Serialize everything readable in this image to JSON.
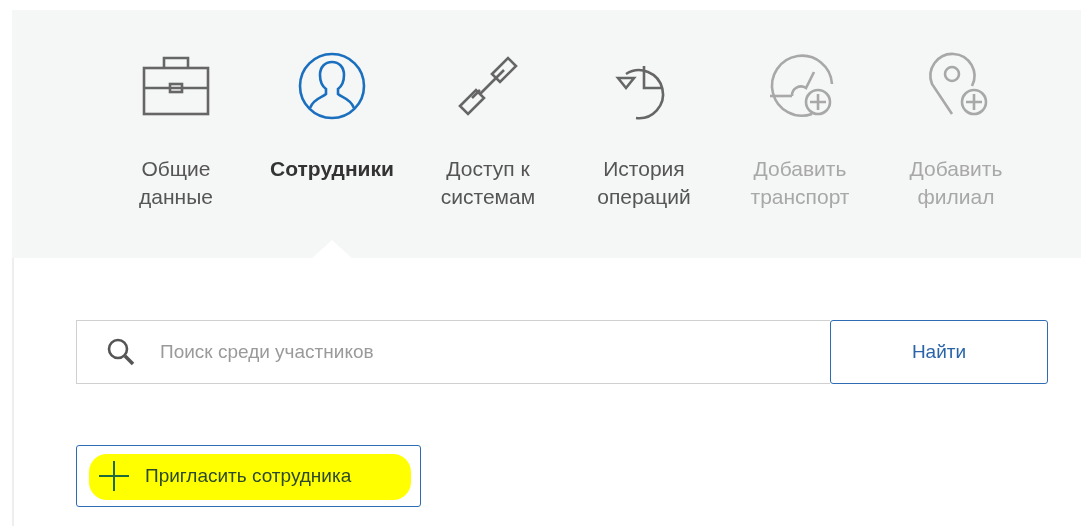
{
  "tabs": [
    {
      "label": "Общие\nданные",
      "selected": false,
      "disabled": false
    },
    {
      "label": "Сотрудники",
      "selected": true,
      "disabled": false
    },
    {
      "label": "Доступ к\nсистемам",
      "selected": false,
      "disabled": false
    },
    {
      "label": "История\nопераций",
      "selected": false,
      "disabled": false
    },
    {
      "label": "Добавить\nтранспорт",
      "selected": false,
      "disabled": true
    },
    {
      "label": "Добавить\nфилиал",
      "selected": false,
      "disabled": true
    }
  ],
  "search": {
    "placeholder": "Поиск среди участников",
    "button": "Найти"
  },
  "invite_button": {
    "label": "Пригласить сотрудника",
    "highlighted": true
  }
}
